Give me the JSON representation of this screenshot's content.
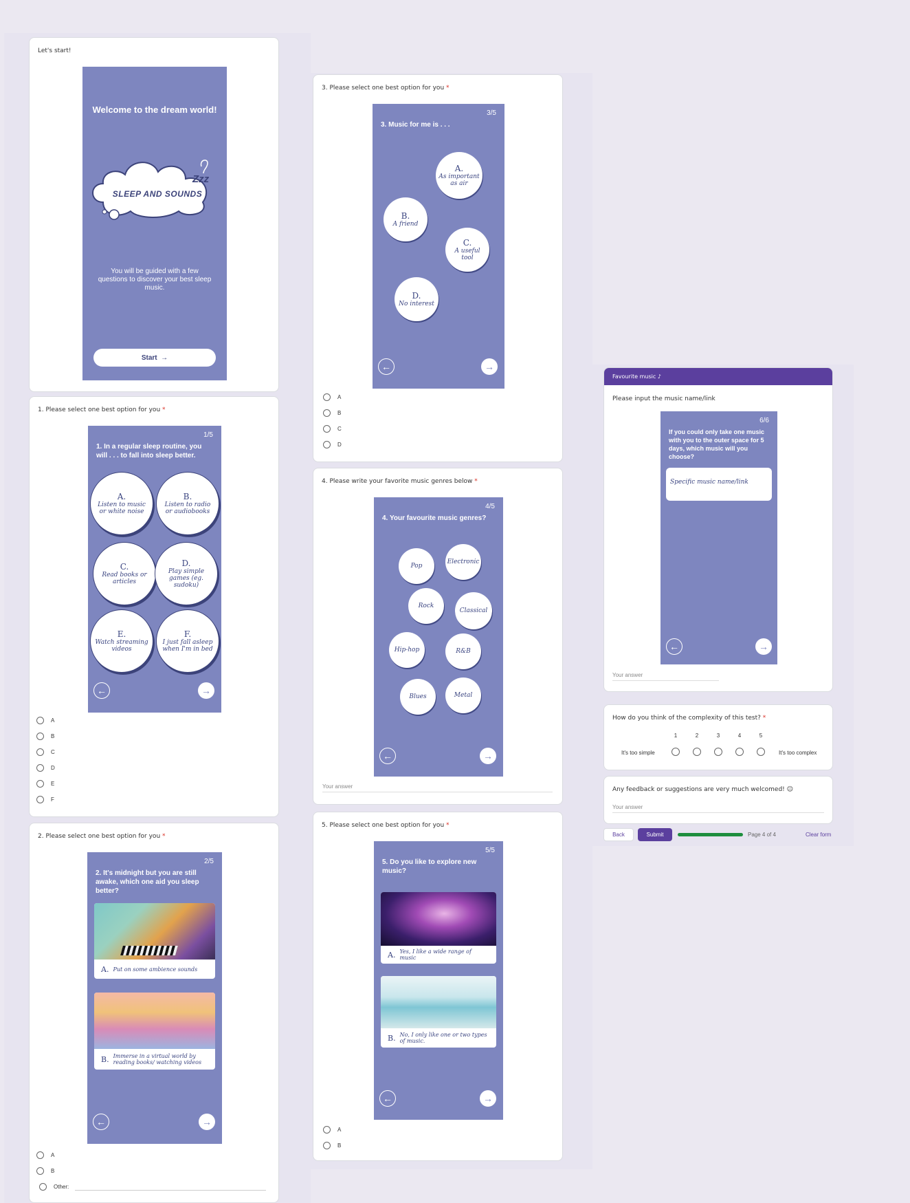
{
  "col1": {
    "intro": {
      "label": "Let's start!",
      "title": "Welcome to the dream world!",
      "logo": "SLEEP AND SOUNDS",
      "zzz": "Zzz",
      "description": "You will be guided with a few questions to discover your best sleep music.",
      "start": "Start",
      "arrow": "→"
    },
    "q1": {
      "label": "1. Please select one best option for you",
      "required": "*",
      "num": "1/5",
      "title": "1. In a regular sleep routine, you will . . . to fall into sleep better.",
      "options": [
        {
          "l": "A.",
          "t": "Listen to music or white noise"
        },
        {
          "l": "B.",
          "t": "Listen to radio or audiobooks"
        },
        {
          "l": "C.",
          "t": "Read books or articles"
        },
        {
          "l": "D.",
          "t": "Play simple games (eg. sudoku)"
        },
        {
          "l": "E.",
          "t": "Watch streaming videos"
        },
        {
          "l": "F.",
          "t": "I just fall asleep when I'm in bed"
        }
      ],
      "radios": [
        "A",
        "B",
        "C",
        "D",
        "E",
        "F"
      ]
    },
    "q2": {
      "label": "2. Please select one best option for you",
      "required": "*",
      "num": "2/5",
      "title": "2. It's midnight but you are still awake, which one aid you sleep better?",
      "optA": {
        "l": "A.",
        "t": "Put on some ambience sounds"
      },
      "optB": {
        "l": "B.",
        "t": "Immerse in a virtual world by reading books/ watching videos"
      },
      "radios": [
        "A",
        "B"
      ],
      "other": "Other:"
    }
  },
  "col2": {
    "q3": {
      "label": "3. Please select one best option for you",
      "required": "*",
      "num": "3/5",
      "title": "3. Music for me is . . .",
      "options": [
        {
          "l": "A.",
          "t": "As important as air"
        },
        {
          "l": "B.",
          "t": "A friend"
        },
        {
          "l": "C.",
          "t": "A useful tool"
        },
        {
          "l": "D.",
          "t": "No interest"
        }
      ],
      "radios": [
        "A",
        "B",
        "C",
        "D"
      ]
    },
    "q4": {
      "label": "4. Please write your favorite music genres below",
      "required": "*",
      "num": "4/5",
      "title": "4. Your favourite music genres?",
      "genres": [
        "Pop",
        "Electronic",
        "Rock",
        "Classical",
        "Hip-hop",
        "R&B",
        "Blues",
        "Metal"
      ],
      "answer": "Your answer"
    },
    "q5": {
      "label": "5. Please select one best option for you",
      "required": "*",
      "num": "5/5",
      "title": "5. Do you like to explore new music?",
      "optA": {
        "l": "A.",
        "t": "Yes, I like a wide range of music"
      },
      "optB": {
        "l": "B.",
        "t": "No, I only like one or two types of music."
      },
      "radios": [
        "A",
        "B"
      ]
    }
  },
  "col3": {
    "header": "Favourite music ♪",
    "q6": {
      "label": "Please input the music name/link",
      "num": "6/6",
      "title": "If you could only take one music with you to the outer space for 5 days, which music will you choose?",
      "input": "Specific music name/link",
      "answer": "Your answer"
    },
    "q7": {
      "label": "How do you think of the complexity of this test?",
      "required": "*",
      "scale": [
        "1",
        "2",
        "3",
        "4",
        "5"
      ],
      "low": "It's too simple",
      "high": "It's too complex"
    },
    "q8": {
      "label": "Any feedback or suggestions are very much welcomed! ☺",
      "answer": "Your answer"
    },
    "footer": {
      "back": "Back",
      "submit": "Submit",
      "progress": 1.0,
      "page": "Page 4 of 4",
      "clear": "Clear form"
    }
  },
  "colors": {
    "phone": "#7e86bf",
    "accent": "#5b3f9e",
    "progress": "#1e8e3e",
    "required": "#d93025"
  }
}
